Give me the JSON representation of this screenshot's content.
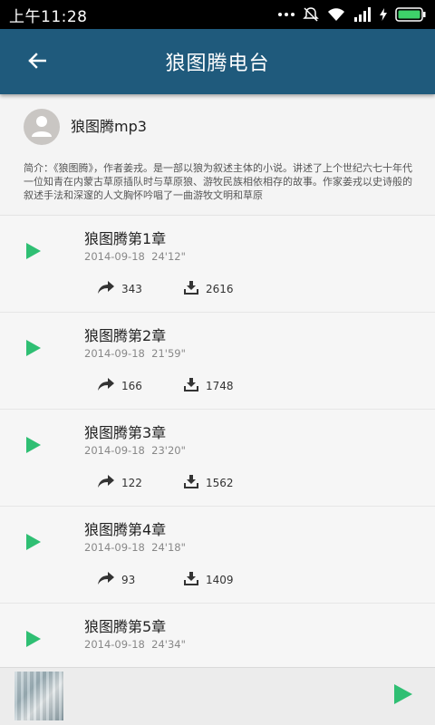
{
  "status_bar": {
    "time": "上午11:28"
  },
  "header": {
    "title": "狼图腾电台",
    "back_icon": "arrow-left-icon"
  },
  "album": {
    "name": "狼图腾mp3",
    "description": "简介：《狼图腾》，作者姜戎。是一部以狼为叙述主体的小说。讲述了上个世纪六七十年代一位知青在内蒙古草原插队时与草原狼、游牧民族相依相存的故事。作家姜戎以史诗般的叙述手法和深邃的人文胸怀吟唱了一曲游牧文明和草原"
  },
  "episodes": [
    {
      "title": "狼图腾第1章",
      "date": "2014-09-18",
      "duration": "24'12\"",
      "shares": "343",
      "downloads": "2616"
    },
    {
      "title": "狼图腾第2章",
      "date": "2014-09-18",
      "duration": "21'59\"",
      "shares": "166",
      "downloads": "1748"
    },
    {
      "title": "狼图腾第3章",
      "date": "2014-09-18",
      "duration": "23'20\"",
      "shares": "122",
      "downloads": "1562"
    },
    {
      "title": "狼图腾第4章",
      "date": "2014-09-18",
      "duration": "24'18\"",
      "shares": "93",
      "downloads": "1409"
    },
    {
      "title": "狼图腾第5章",
      "date": "2014-09-18",
      "duration": "24'34\"",
      "shares": "",
      "downloads": ""
    }
  ],
  "colors": {
    "app_bar": "#1f5a7c",
    "play_green": "#2fbf73"
  }
}
